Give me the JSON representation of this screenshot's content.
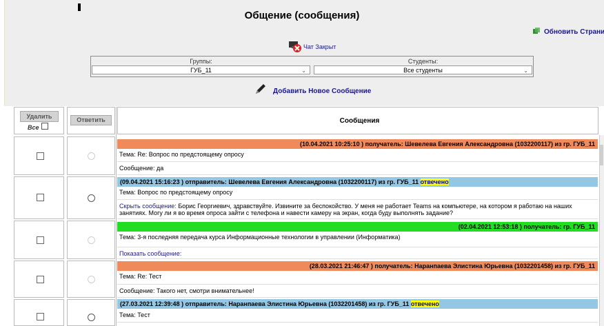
{
  "page": {
    "title": "Общение (сообщения)",
    "refresh_label": "Обновить Страни",
    "chat_status": "Чат Закрыт",
    "add_message_label": "Добавить Новое Сообщение"
  },
  "filters": {
    "groups_label": "Группы:",
    "groups_value": "ГУБ_11",
    "students_label": "Студенты:",
    "students_value": "Все студенты"
  },
  "table_header": {
    "delete_label": "Удалить",
    "all_label": "Все",
    "reply_label": "Ответить",
    "messages_label": "Сообщения"
  },
  "messages": [
    {
      "header": "(10.04.2021 10:25:10 ) получатель: Шевелева Евгения Александровна (1032200117) из гр. ГУБ_11",
      "topic": "Тема: Re: Вопрос по предстоящему опросу",
      "body": "Сообщение: да"
    },
    {
      "header": "(09.04.2021 15:16:23 ) отправитель: Шевелева Евгения Александровна (1032200117) из гр. ГУБ_11",
      "status": "отвечено",
      "topic": "Тема: Вопрос по предстоящему опросу",
      "hide_link": "Скрыть сообщение:",
      "body": "Борис Георгиевич, здравствуйте. Извините за беспокойство. У меня не работает Teams на компьютере, на котором я работаю на наших занятиях. Могу ли я во время опроса зайти с телефона и навести камеру на экран, когда буду выполнять задание?"
    },
    {
      "header": "(02.04.2021 12:53:18 ) получатель: гр. ГУБ_11",
      "topic": "Тема: 3-я последняя передача курса Информационные технологии в управлении (Информатика)",
      "show_link": "Показать сообщение:"
    },
    {
      "header": "(28.03.2021 21:46:47 ) получатель: Наранпаева Элистина Юрьевна (1032201458) из гр. ГУБ_11",
      "topic": "Тема: Re: Тест",
      "body": "Сообщение: Такого нет, смотри внимательнее!"
    },
    {
      "header": "(27.03.2021 12:39:48 ) отправитель: Наранпаева Элистина Юрьевна (1032201458) из гр. ГУБ_11",
      "status": "отвечено",
      "topic": "Тема: Тест"
    }
  ],
  "colors": {
    "sent": "#f08a5a",
    "received": "#94c7e3",
    "group": "#22dd22",
    "answered_highlight": "#ffff00"
  }
}
